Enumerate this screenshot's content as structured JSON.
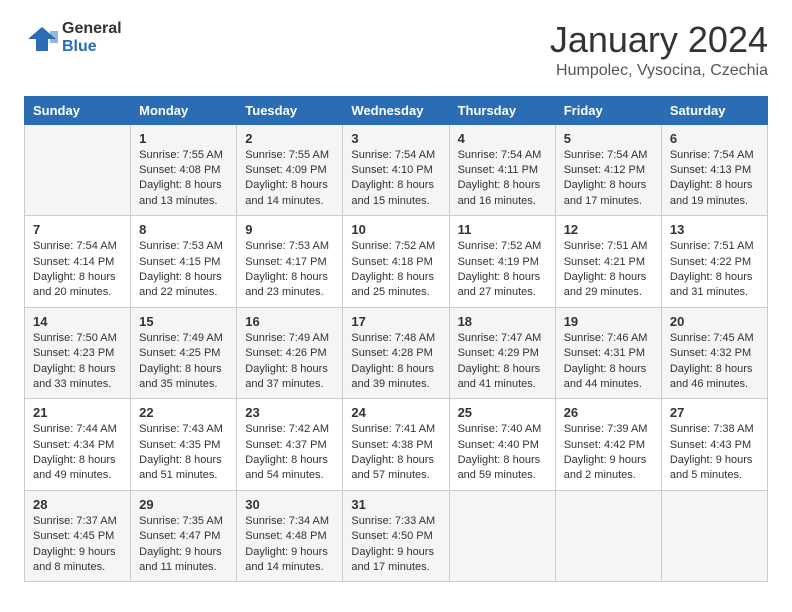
{
  "header": {
    "logo_general": "General",
    "logo_blue": "Blue",
    "title": "January 2024",
    "subtitle": "Humpolec, Vysocina, Czechia"
  },
  "calendar": {
    "weekdays": [
      "Sunday",
      "Monday",
      "Tuesday",
      "Wednesday",
      "Thursday",
      "Friday",
      "Saturday"
    ],
    "weeks": [
      [
        {
          "day": "",
          "sunrise": "",
          "sunset": "",
          "daylight": ""
        },
        {
          "day": "1",
          "sunrise": "Sunrise: 7:55 AM",
          "sunset": "Sunset: 4:08 PM",
          "daylight": "Daylight: 8 hours and 13 minutes."
        },
        {
          "day": "2",
          "sunrise": "Sunrise: 7:55 AM",
          "sunset": "Sunset: 4:09 PM",
          "daylight": "Daylight: 8 hours and 14 minutes."
        },
        {
          "day": "3",
          "sunrise": "Sunrise: 7:54 AM",
          "sunset": "Sunset: 4:10 PM",
          "daylight": "Daylight: 8 hours and 15 minutes."
        },
        {
          "day": "4",
          "sunrise": "Sunrise: 7:54 AM",
          "sunset": "Sunset: 4:11 PM",
          "daylight": "Daylight: 8 hours and 16 minutes."
        },
        {
          "day": "5",
          "sunrise": "Sunrise: 7:54 AM",
          "sunset": "Sunset: 4:12 PM",
          "daylight": "Daylight: 8 hours and 17 minutes."
        },
        {
          "day": "6",
          "sunrise": "Sunrise: 7:54 AM",
          "sunset": "Sunset: 4:13 PM",
          "daylight": "Daylight: 8 hours and 19 minutes."
        }
      ],
      [
        {
          "day": "7",
          "sunrise": "Sunrise: 7:54 AM",
          "sunset": "Sunset: 4:14 PM",
          "daylight": "Daylight: 8 hours and 20 minutes."
        },
        {
          "day": "8",
          "sunrise": "Sunrise: 7:53 AM",
          "sunset": "Sunset: 4:15 PM",
          "daylight": "Daylight: 8 hours and 22 minutes."
        },
        {
          "day": "9",
          "sunrise": "Sunrise: 7:53 AM",
          "sunset": "Sunset: 4:17 PM",
          "daylight": "Daylight: 8 hours and 23 minutes."
        },
        {
          "day": "10",
          "sunrise": "Sunrise: 7:52 AM",
          "sunset": "Sunset: 4:18 PM",
          "daylight": "Daylight: 8 hours and 25 minutes."
        },
        {
          "day": "11",
          "sunrise": "Sunrise: 7:52 AM",
          "sunset": "Sunset: 4:19 PM",
          "daylight": "Daylight: 8 hours and 27 minutes."
        },
        {
          "day": "12",
          "sunrise": "Sunrise: 7:51 AM",
          "sunset": "Sunset: 4:21 PM",
          "daylight": "Daylight: 8 hours and 29 minutes."
        },
        {
          "day": "13",
          "sunrise": "Sunrise: 7:51 AM",
          "sunset": "Sunset: 4:22 PM",
          "daylight": "Daylight: 8 hours and 31 minutes."
        }
      ],
      [
        {
          "day": "14",
          "sunrise": "Sunrise: 7:50 AM",
          "sunset": "Sunset: 4:23 PM",
          "daylight": "Daylight: 8 hours and 33 minutes."
        },
        {
          "day": "15",
          "sunrise": "Sunrise: 7:49 AM",
          "sunset": "Sunset: 4:25 PM",
          "daylight": "Daylight: 8 hours and 35 minutes."
        },
        {
          "day": "16",
          "sunrise": "Sunrise: 7:49 AM",
          "sunset": "Sunset: 4:26 PM",
          "daylight": "Daylight: 8 hours and 37 minutes."
        },
        {
          "day": "17",
          "sunrise": "Sunrise: 7:48 AM",
          "sunset": "Sunset: 4:28 PM",
          "daylight": "Daylight: 8 hours and 39 minutes."
        },
        {
          "day": "18",
          "sunrise": "Sunrise: 7:47 AM",
          "sunset": "Sunset: 4:29 PM",
          "daylight": "Daylight: 8 hours and 41 minutes."
        },
        {
          "day": "19",
          "sunrise": "Sunrise: 7:46 AM",
          "sunset": "Sunset: 4:31 PM",
          "daylight": "Daylight: 8 hours and 44 minutes."
        },
        {
          "day": "20",
          "sunrise": "Sunrise: 7:45 AM",
          "sunset": "Sunset: 4:32 PM",
          "daylight": "Daylight: 8 hours and 46 minutes."
        }
      ],
      [
        {
          "day": "21",
          "sunrise": "Sunrise: 7:44 AM",
          "sunset": "Sunset: 4:34 PM",
          "daylight": "Daylight: 8 hours and 49 minutes."
        },
        {
          "day": "22",
          "sunrise": "Sunrise: 7:43 AM",
          "sunset": "Sunset: 4:35 PM",
          "daylight": "Daylight: 8 hours and 51 minutes."
        },
        {
          "day": "23",
          "sunrise": "Sunrise: 7:42 AM",
          "sunset": "Sunset: 4:37 PM",
          "daylight": "Daylight: 8 hours and 54 minutes."
        },
        {
          "day": "24",
          "sunrise": "Sunrise: 7:41 AM",
          "sunset": "Sunset: 4:38 PM",
          "daylight": "Daylight: 8 hours and 57 minutes."
        },
        {
          "day": "25",
          "sunrise": "Sunrise: 7:40 AM",
          "sunset": "Sunset: 4:40 PM",
          "daylight": "Daylight: 8 hours and 59 minutes."
        },
        {
          "day": "26",
          "sunrise": "Sunrise: 7:39 AM",
          "sunset": "Sunset: 4:42 PM",
          "daylight": "Daylight: 9 hours and 2 minutes."
        },
        {
          "day": "27",
          "sunrise": "Sunrise: 7:38 AM",
          "sunset": "Sunset: 4:43 PM",
          "daylight": "Daylight: 9 hours and 5 minutes."
        }
      ],
      [
        {
          "day": "28",
          "sunrise": "Sunrise: 7:37 AM",
          "sunset": "Sunset: 4:45 PM",
          "daylight": "Daylight: 9 hours and 8 minutes."
        },
        {
          "day": "29",
          "sunrise": "Sunrise: 7:35 AM",
          "sunset": "Sunset: 4:47 PM",
          "daylight": "Daylight: 9 hours and 11 minutes."
        },
        {
          "day": "30",
          "sunrise": "Sunrise: 7:34 AM",
          "sunset": "Sunset: 4:48 PM",
          "daylight": "Daylight: 9 hours and 14 minutes."
        },
        {
          "day": "31",
          "sunrise": "Sunrise: 7:33 AM",
          "sunset": "Sunset: 4:50 PM",
          "daylight": "Daylight: 9 hours and 17 minutes."
        },
        {
          "day": "",
          "sunrise": "",
          "sunset": "",
          "daylight": ""
        },
        {
          "day": "",
          "sunrise": "",
          "sunset": "",
          "daylight": ""
        },
        {
          "day": "",
          "sunrise": "",
          "sunset": "",
          "daylight": ""
        }
      ]
    ]
  }
}
